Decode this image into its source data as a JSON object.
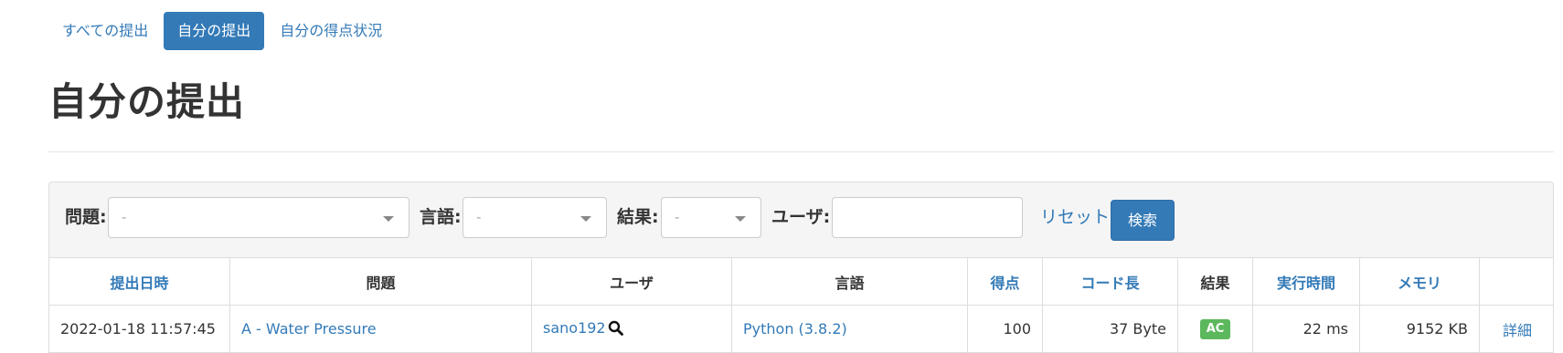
{
  "tabs": [
    {
      "label": "すべての提出",
      "active": false
    },
    {
      "label": "自分の提出",
      "active": true
    },
    {
      "label": "自分の得点状況",
      "active": false
    }
  ],
  "page_title": "自分の提出",
  "filters": {
    "problem_label": "問題:",
    "problem_value": "-",
    "language_label": "言語:",
    "language_value": "-",
    "result_label": "結果:",
    "result_value": "-",
    "user_label": "ユーザ:",
    "user_value": "",
    "reset_label": "リセット",
    "search_label": "検索"
  },
  "table": {
    "headers": {
      "submit_time": "提出日時",
      "problem": "問題",
      "user": "ユーザ",
      "language": "言語",
      "score": "得点",
      "code_length": "コード長",
      "result": "結果",
      "exec_time": "実行時間",
      "memory": "メモリ",
      "detail": ""
    },
    "rows": [
      {
        "submit_time": "2022-01-18 11:57:45",
        "problem": "A - Water Pressure",
        "user": "sano192",
        "language": "Python (3.8.2)",
        "score": "100",
        "code_length": "37 Byte",
        "result": "AC",
        "exec_time": "22 ms",
        "memory": "9152 KB",
        "detail": "詳細"
      }
    ]
  },
  "colors": {
    "accent": "#337ab7",
    "ac_badge": "#5cb85c",
    "panel_bg": "#f5f5f5"
  }
}
